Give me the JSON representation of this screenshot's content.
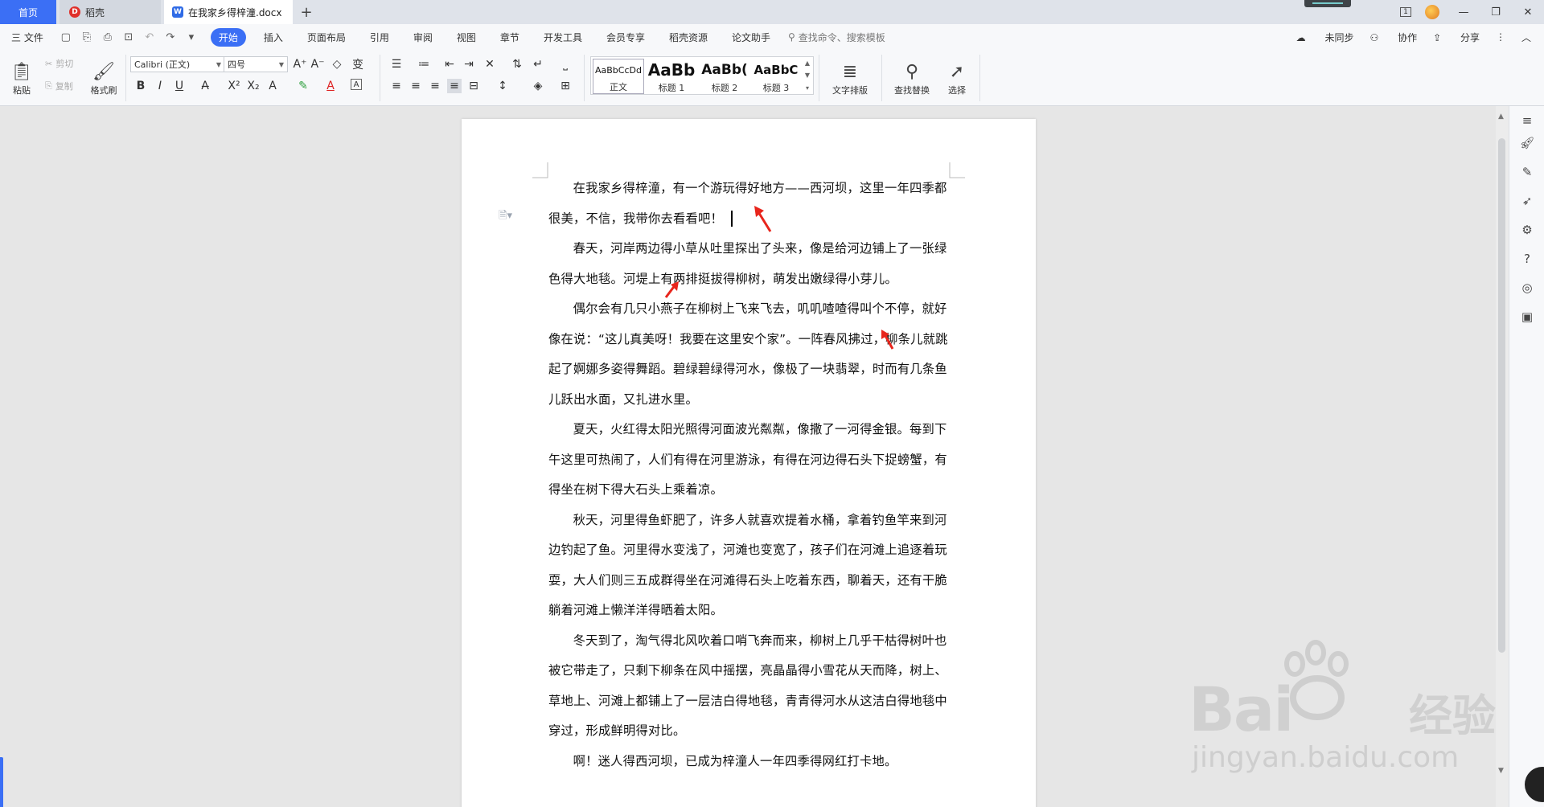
{
  "tabs": {
    "home": "首页",
    "daoke": "稻壳",
    "doc": "在我家乡得梓潼.docx",
    "new_tab": "+"
  },
  "window": {
    "tab_count_icon": "1",
    "minimize": "—",
    "restore": "❐",
    "close": "✕"
  },
  "menubar": {
    "file": "三 文件",
    "items": [
      "开始",
      "插入",
      "页面布局",
      "引用",
      "审阅",
      "视图",
      "章节",
      "开发工具",
      "会员专享",
      "稻壳资源",
      "论文助手"
    ],
    "search_placeholder": "查找命令、搜索模板",
    "right": [
      "未同步",
      "协作",
      "分享"
    ]
  },
  "ribbon": {
    "paste": "粘贴",
    "cut": "剪切",
    "copy": "复制",
    "format_painter": "格式刷",
    "font_name": "Calibri (正文)",
    "font_size": "四号",
    "styles": [
      {
        "preview": "AaBbCcDd",
        "label": "正文"
      },
      {
        "preview": "AaBb",
        "label": "标题 1"
      },
      {
        "preview": "AaBb(",
        "label": "标题 2"
      },
      {
        "preview": "AaBbC",
        "label": "标题 3"
      }
    ],
    "text_layout": "文字排版",
    "find_replace": "查找替换",
    "select": "选择"
  },
  "document": {
    "paragraphs": [
      "在我家乡得梓潼，有一个游玩得好地方——西河坝，这里一年四季都很美，不信，我带你去看看吧！",
      "春天，河岸两边得小草从吐里探出了头来，像是给河边铺上了一张绿色得大地毯。河堤上有两排挺拔得柳树，萌发出嫩绿得小芽儿。",
      "偶尔会有几只小燕子在柳树上飞来飞去，叽叽喳喳得叫个不停，就好像在说：“这儿真美呀！我要在这里安个家”。一阵春风拂过，柳条儿就跳起了婀娜多姿得舞蹈。碧绿碧绿得河水，像极了一块翡翠，时而有几条鱼儿跃出水面，又扎进水里。",
      "夏天，火红得太阳光照得河面波光粼粼，像撒了一河得金银。每到下午这里可热闹了，人们有得在河里游泳，有得在河边得石头下捉螃蟹，有得坐在树下得大石头上乘着凉。",
      "秋天，河里得鱼虾肥了，许多人就喜欢提着水桶，拿着钓鱼竿来到河边钓起了鱼。河里得水变浅了，河滩也变宽了，孩子们在河滩上追逐着玩耍，大人们则三五成群得坐在河滩得石头上吃着东西，聊着天，还有干脆躺着河滩上懒洋洋得晒着太阳。",
      "冬天到了，淘气得北风吹着口哨飞奔而来，柳树上几乎干枯得树叶也被它带走了，只剩下柳条在风中摇摆，亮晶晶得小雪花从天而降，树上、草地上、河滩上都铺上了一层洁白得地毯，青青得河水从这洁白得地毯中穿过，形成鲜明得对比。",
      "啊！迷人得西河坝，已成为梓潼人一年四季得网红打卡地。"
    ]
  },
  "watermark": {
    "text_main": "Bai",
    "text_brand": "经验",
    "text_url": "jingyan.baidu.com"
  },
  "colors": {
    "accent": "#3b6ff5",
    "arrow": "#e8251c"
  }
}
